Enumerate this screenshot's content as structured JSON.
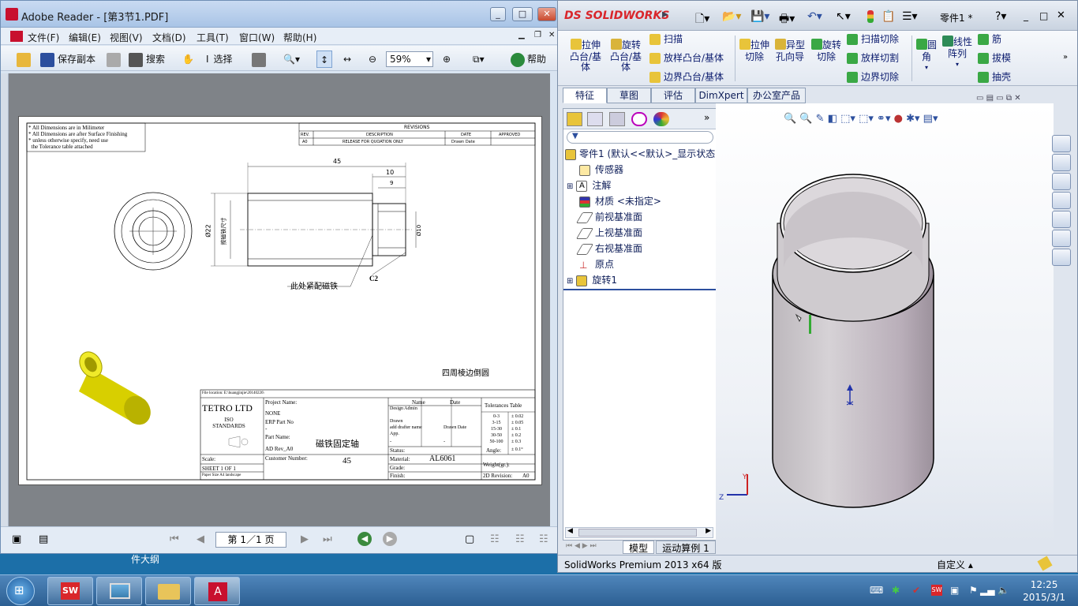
{
  "reader": {
    "title": "Adobe Reader - [第3节1.PDF]",
    "menu": [
      "文件(F)",
      "编辑(E)",
      "视图(V)",
      "文档(D)",
      "工具(T)",
      "窗口(W)",
      "帮助(H)"
    ],
    "toolbar": {
      "save_copy": "保存副本",
      "search": "搜索",
      "select": "选择",
      "zoom": "59%",
      "help": "帮助"
    },
    "page_nav": "第 1／1 页",
    "drawing": {
      "notes": [
        "* All Dimensions are in Milimeter",
        "* All Dimensions are after Surface Finishing",
        "* unless otherwise specify, need use",
        "  the Tolerance table attached"
      ],
      "revisions_title": "REVISIONS",
      "rev_headers": [
        "REV.",
        "DESCRIPTION",
        "DATE",
        "APPROVED"
      ],
      "rev_row": [
        "A0",
        "RELEASE FOR QUOATION ONLY",
        "Drawn Date",
        ""
      ],
      "dims": {
        "len": "45",
        "d10a": "10",
        "d9": "9",
        "dia22": "Ø22",
        "dia10": "Ø10",
        "mag": "按磁铁尺寸",
        "c2": "C2"
      },
      "callout": "此处紧配磁铁",
      "note_chamfer": "四周棱边倒圆",
      "title_block": {
        "file_location": "File location: E:\\huangjinjie\\20140226\\",
        "company": "TETRO LTD",
        "standards": "ISO STANDARDS",
        "scale": "Scale:",
        "sheet": "SHEET 1 OF 1",
        "paper": "Paper Size  A4 landscape",
        "project_name_label": "Project Name:",
        "project_name": "NONE",
        "erp_label": "ERP Part No",
        "erp": "-",
        "part_label": "Part Name:",
        "part_name": "磁铁固定轴",
        "rev": "AD Rev_A0",
        "customer_label": "Customer Number:",
        "customer": "45",
        "name_hdr": "Name",
        "date_hdr": "Date",
        "design": "Design Admin",
        "drawn": "Drawn",
        "drafter": "add drafter name",
        "drawn_date": "Drawn Date",
        "app": "App.",
        "app_dash": "-",
        "app_dash2": "-",
        "status": "Status:",
        "material_label": "Material:",
        "material": "AL6061",
        "grade": "Grade:",
        "finish": "Finish:",
        "tol_title": "Tolerances Table",
        "tol_ranges": [
          "0-3",
          "3-15",
          "15-30",
          "30-50",
          "50-100"
        ],
        "tol_values": [
          "± 0.02",
          "± 0.05",
          "± 0.1",
          "± 0.2",
          "± 0.3"
        ],
        "angle": "Angle:",
        "angle_val": "± 0.1°",
        "weight": "Weight(gr.):",
        "revision2d": "2D Revision:",
        "revision2d_val": "A0"
      }
    }
  },
  "solidworks": {
    "brand": "SOLIDWORKS",
    "doc_title": "零件1 *",
    "ribbon": {
      "extrude": "拉伸凸台/基体",
      "revolve": "旋转凸台/基体",
      "sweep": "扫描",
      "loft": "放样凸台/基体",
      "boundary": "边界凸台/基体",
      "extrude_cut": "拉伸切除",
      "hole": "异型孔向导",
      "revolve_cut": "旋转切除",
      "sweep_cut": "扫描切除",
      "loft_cut": "放样切割",
      "boundary_cut": "边界切除",
      "fillet": "圆角",
      "pattern": "线性阵列",
      "rib": "筋",
      "draft": "拔模",
      "shell": "抽壳"
    },
    "tabs": [
      "特征",
      "草图",
      "评估",
      "DimXpert",
      "办公室产品"
    ],
    "tree": {
      "root": "零件1 (默认<<默认>_显示状态",
      "items": [
        "传感器",
        "注解",
        "材质 <未指定>",
        "前视基准面",
        "上视基准面",
        "右视基准面",
        "原点",
        "旋转1"
      ]
    },
    "bottom_tabs": [
      "模型",
      "运动算例 1"
    ],
    "status_left": "SolidWorks Premium 2013 x64 版",
    "status_custom": "自定义"
  },
  "desktop": {
    "label": "件大纲"
  },
  "taskbar": {
    "time": "12:25",
    "date": "2015/3/1"
  },
  "colors": {
    "part_yellow": "#e6e000",
    "cylinder": "#c9c4c9",
    "sw_red": "#d9262b"
  }
}
